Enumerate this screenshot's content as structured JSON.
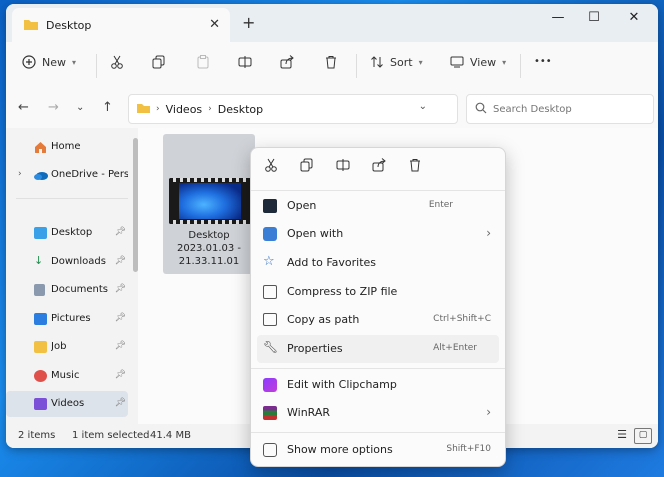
{
  "tab": {
    "title": "Desktop",
    "close": "✕",
    "new_tab": "+"
  },
  "window_controls": {
    "minimize": "—",
    "maximize": "☐",
    "close": "✕"
  },
  "toolbar": {
    "new_label": "New",
    "sort_label": "Sort",
    "view_label": "View",
    "more_label": "•••"
  },
  "address": {
    "crumbs": [
      "Videos",
      "Desktop"
    ]
  },
  "search": {
    "placeholder": "Search Desktop"
  },
  "sidebar": {
    "items": [
      {
        "label": "Home"
      },
      {
        "label": "OneDrive - Persona"
      },
      {
        "label": "Desktop"
      },
      {
        "label": "Downloads"
      },
      {
        "label": "Documents"
      },
      {
        "label": "Pictures"
      },
      {
        "label": "Job"
      },
      {
        "label": "Music"
      },
      {
        "label": "Videos"
      }
    ]
  },
  "file": {
    "name_line1": "Desktop",
    "name_line2": "2023.01.03 -",
    "name_line3": "21.33.11.01"
  },
  "status": {
    "items": "2 items",
    "selected": "1 item selected",
    "size": "41.4 MB"
  },
  "context_menu": {
    "items": [
      {
        "label": "Open",
        "shortcut": "Enter"
      },
      {
        "label": "Open with",
        "shortcut": "›"
      },
      {
        "label": "Add to Favorites",
        "shortcut": ""
      },
      {
        "label": "Compress to ZIP file",
        "shortcut": ""
      },
      {
        "label": "Copy as path",
        "shortcut": "Ctrl+Shift+C"
      },
      {
        "label": "Properties",
        "shortcut": "Alt+Enter"
      },
      {
        "label": "Edit with Clipchamp",
        "shortcut": ""
      },
      {
        "label": "WinRAR",
        "shortcut": "›"
      },
      {
        "label": "Show more options",
        "shortcut": "Shift+F10"
      }
    ]
  },
  "colors": {
    "accent": "#0067c0",
    "folder": "#f2c144",
    "window_bg": "#f3f3f3"
  }
}
